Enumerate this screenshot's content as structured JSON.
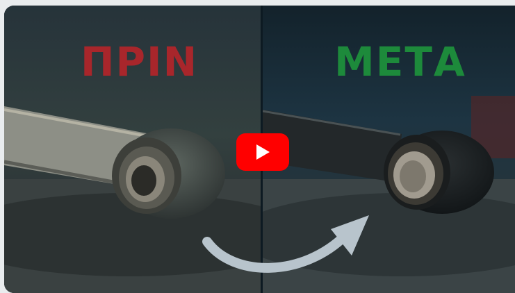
{
  "overlay": {
    "before_label": "ΠΡΙΝ",
    "after_label": "ΜΕΤΑ"
  },
  "colors": {
    "before": "#a8262b",
    "after": "#1d8a3b",
    "play_button": "#ff0000",
    "arrow": "#b8c4cc"
  },
  "icons": {
    "play": "play-icon",
    "arrow": "curved-arrow-icon"
  }
}
